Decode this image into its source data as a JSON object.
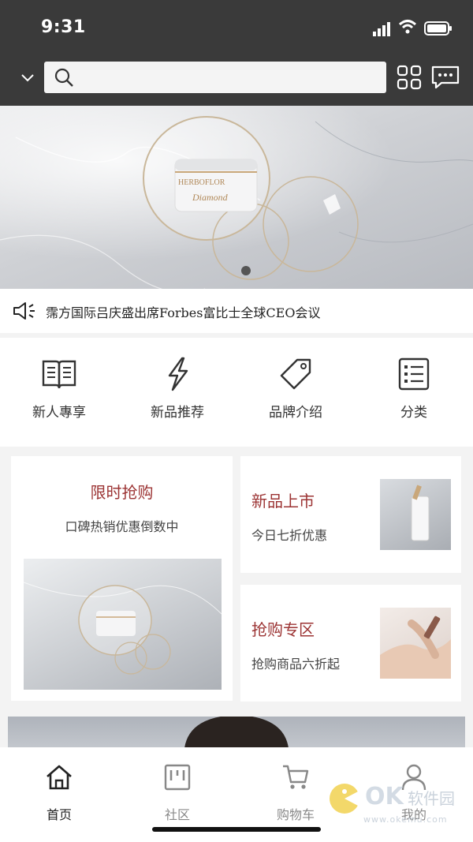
{
  "status": {
    "time": "9:31"
  },
  "search": {
    "placeholder": ""
  },
  "banner": {
    "product_brand": "HERBOFLOR",
    "product_script": "Diamond"
  },
  "notice": {
    "text": "霈方国际吕庆盛出席Forbes富比士全球CEO会议"
  },
  "quick": [
    {
      "label": "新人專享",
      "icon": "book-icon"
    },
    {
      "label": "新品推荐",
      "icon": "lightning-icon"
    },
    {
      "label": "品牌介绍",
      "icon": "tag-icon"
    },
    {
      "label": "分类",
      "icon": "list-icon"
    }
  ],
  "cards": {
    "flash": {
      "title": "限时抢购",
      "subtitle": "口碑热销优惠倒数中"
    },
    "new": {
      "title": "新品上市",
      "subtitle": "今日七折优惠"
    },
    "buy": {
      "title": "抢购专区",
      "subtitle": "抢购商品六折起"
    }
  },
  "tabs": [
    {
      "label": "首页",
      "icon": "home-icon",
      "active": true
    },
    {
      "label": "社区",
      "icon": "community-icon",
      "active": false
    },
    {
      "label": "购物车",
      "icon": "cart-icon",
      "active": false
    },
    {
      "label": "我的",
      "icon": "user-icon",
      "active": false
    }
  ],
  "watermark": {
    "brand": "OK",
    "name": "软件园",
    "url": "www.okemu.com"
  },
  "colors": {
    "accent": "#9c3434",
    "topbar": "#3a3a3a"
  }
}
